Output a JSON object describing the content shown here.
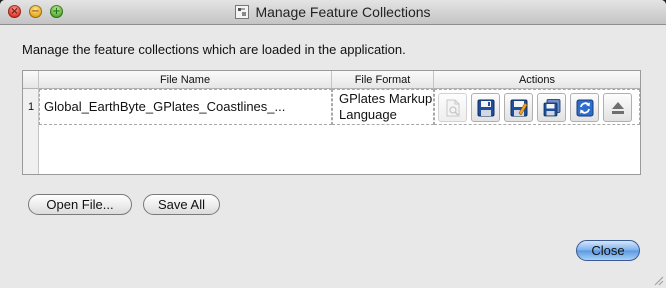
{
  "window": {
    "title": "Manage Feature Collections",
    "controls": {
      "close_symbol": "×",
      "minimize_symbol": "−",
      "zoom_symbol": "+"
    }
  },
  "description": "Manage the feature collections which are loaded in the application.",
  "table": {
    "columns": [
      "File Name",
      "File Format",
      "Actions"
    ],
    "rows": [
      {
        "index": "1",
        "file_name": "Global_EarthByte_GPlates_Coastlines_...",
        "file_format": "GPlates Markup Language",
        "actions": [
          "edit-configuration-icon",
          "save-icon",
          "save-as-icon",
          "save-copy-icon",
          "reload-icon",
          "unload-icon"
        ]
      }
    ]
  },
  "buttons": {
    "open_file": "Open File...",
    "save_all": "Save All",
    "close": "Close"
  },
  "colors": {
    "accent": "#5c98e2",
    "save_blue": "#1f4f9c"
  }
}
